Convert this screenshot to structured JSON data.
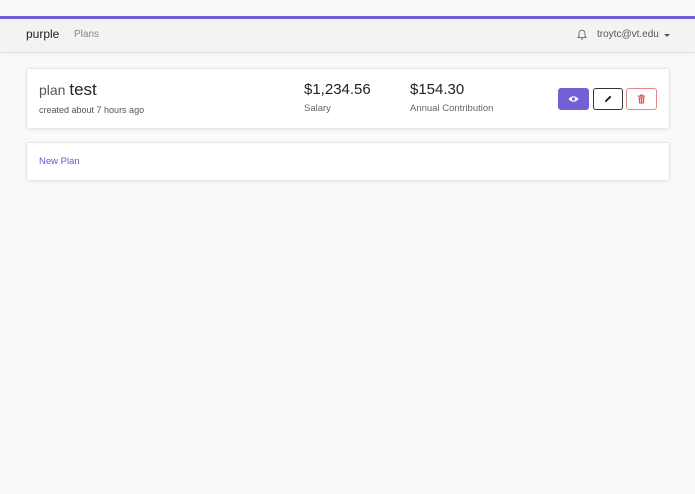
{
  "navbar": {
    "brand": "purple",
    "links": [
      {
        "label": "Plans"
      }
    ],
    "user_email": "troytc@vt.edu"
  },
  "plans": [
    {
      "prefix": "plan",
      "name": "test",
      "created": "created about 7 hours ago",
      "salary_value": "$1,234.56",
      "salary_label": "Salary",
      "contribution_value": "$154.30",
      "contribution_label": "Annual Contribution",
      "actions": {
        "view_icon": "eye-icon",
        "edit_icon": "pencil-icon",
        "delete_icon": "trash-icon"
      }
    }
  ],
  "new_plan_label": "New Plan",
  "colors": {
    "accent": "#7460d6",
    "danger": "#d9534f",
    "background": "#fafafa"
  }
}
